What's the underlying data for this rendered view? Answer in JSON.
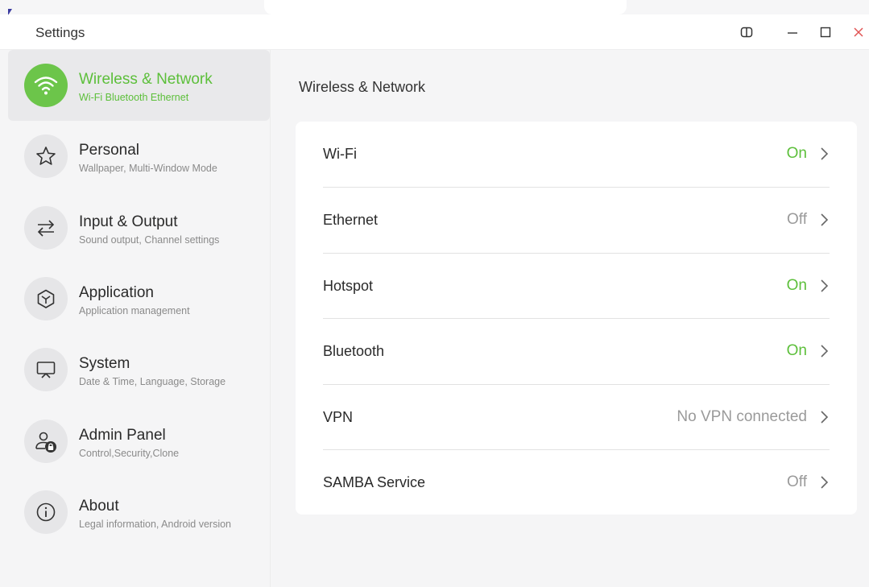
{
  "window": {
    "title": "Settings"
  },
  "colors": {
    "accent": "#5cbf3a",
    "close": "#e05454",
    "muted": "#9a9a9a"
  },
  "sidebar": {
    "items": [
      {
        "label": "Wireless & Network",
        "sub": "Wi-Fi Bluetooth Ethernet",
        "icon": "wifi-icon",
        "active": true
      },
      {
        "label": "Personal",
        "sub": "Wallpaper, Multi-Window Mode",
        "icon": "star-icon",
        "active": false
      },
      {
        "label": "Input & Output",
        "sub": "Sound output, Channel settings",
        "icon": "swap-arrows-icon",
        "active": false
      },
      {
        "label": "Application",
        "sub": "Application management",
        "icon": "cube-icon",
        "active": false
      },
      {
        "label": "System",
        "sub": "Date & Time, Language, Storage",
        "icon": "monitor-icon",
        "active": false
      },
      {
        "label": "Admin Panel",
        "sub": "Control,Security,Clone",
        "icon": "user-lock-icon",
        "active": false
      },
      {
        "label": "About",
        "sub": "Legal information, Android version",
        "icon": "info-icon",
        "active": false
      }
    ]
  },
  "main": {
    "title": "Wireless & Network",
    "rows": [
      {
        "label": "Wi-Fi",
        "value": "On",
        "on": true
      },
      {
        "label": "Ethernet",
        "value": "Off",
        "on": false
      },
      {
        "label": "Hotspot",
        "value": "On",
        "on": true
      },
      {
        "label": "Bluetooth",
        "value": "On",
        "on": true
      },
      {
        "label": "VPN",
        "value": "No VPN connected",
        "on": false
      },
      {
        "label": "SAMBA Service",
        "value": "Off",
        "on": false
      }
    ]
  }
}
